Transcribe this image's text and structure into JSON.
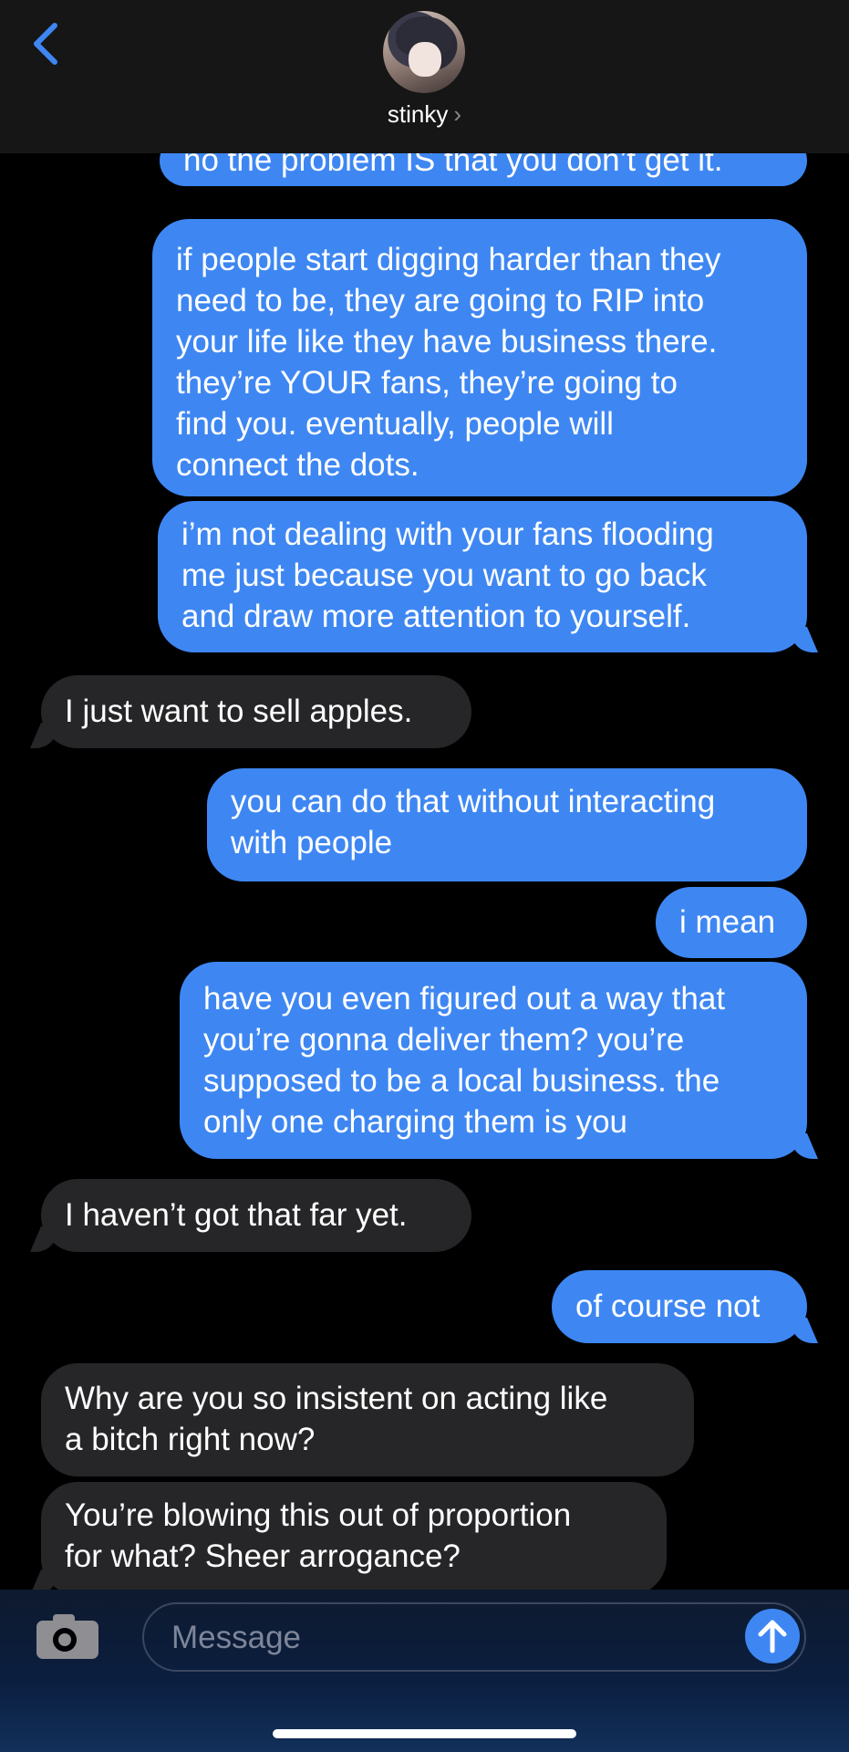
{
  "header": {
    "back_icon": "chevron-left-icon",
    "contact_name": "stinky",
    "contact_chevron": "›"
  },
  "messages": [
    {
      "from": "me",
      "text": "no the problem IS that you don’t get it."
    },
    {
      "from": "me",
      "text": "if people start digging harder than they\nneed to be, they are going to RIP into\nyour life like they have business there.\nthey’re YOUR fans, they’re going to\nfind you. eventually, people will\nconnect the dots."
    },
    {
      "from": "me",
      "text": "i’m not dealing with your fans flooding\nme just because you want to go back\nand draw more attention to yourself."
    },
    {
      "from": "them",
      "text": "I just want to sell apples."
    },
    {
      "from": "me",
      "text": "you can do that without interacting\nwith people"
    },
    {
      "from": "me",
      "text": "i mean"
    },
    {
      "from": "me",
      "text": "have you even figured out a way that\nyou’re gonna deliver them? you’re\nsupposed to be a local business. the\nonly one charging them is you"
    },
    {
      "from": "them",
      "text": "I haven’t got that far yet."
    },
    {
      "from": "me",
      "text": "of course not"
    },
    {
      "from": "them",
      "text": "Why are you so insistent on acting like\na bitch right now?"
    },
    {
      "from": "them",
      "text": "You’re blowing this out of proportion\nfor what? Sheer arrogance?"
    }
  ],
  "composer": {
    "placeholder": "Message",
    "camera_icon": "camera-icon",
    "send_icon": "arrow-up-icon"
  },
  "colors": {
    "sent_bubble": "#3e87f3",
    "received_bubble": "#262628",
    "accent": "#3e87f3"
  }
}
